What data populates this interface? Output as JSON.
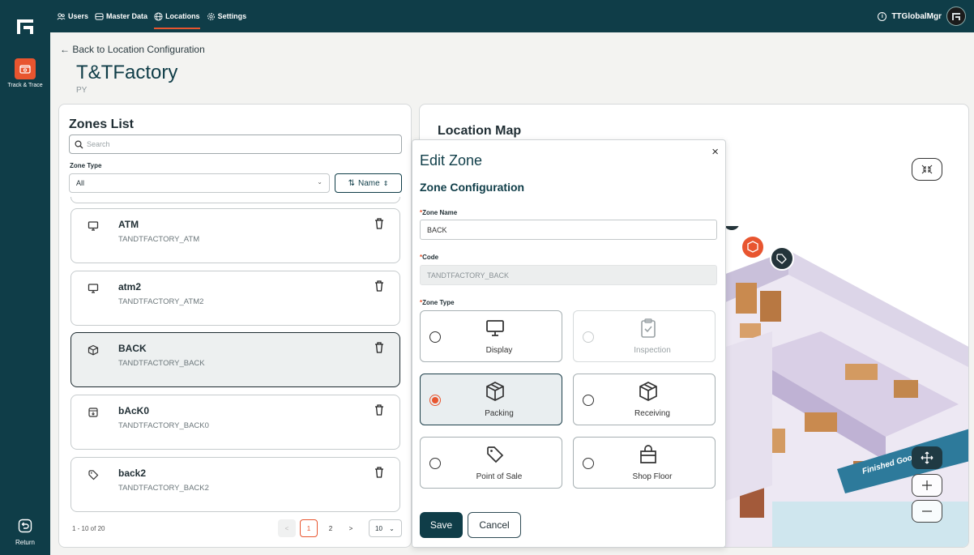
{
  "nav": {
    "items": [
      {
        "label": "Users",
        "icon": "users-icon"
      },
      {
        "label": "Master Data",
        "icon": "database-icon"
      },
      {
        "label": "Locations",
        "icon": "globe-icon"
      },
      {
        "label": "Settings",
        "icon": "gear-icon"
      }
    ],
    "active": "Locations",
    "user": "TTGlobalMgr"
  },
  "rail": {
    "app_label": "Track & Trace",
    "return_label": "Return"
  },
  "header": {
    "back_label": "← Back to Location Configuration",
    "title": "T&TFactory",
    "subtitle": "PY"
  },
  "zones_list": {
    "title": "Zones List",
    "search_placeholder": "Search",
    "zone_type_label": "Zone Type",
    "zone_type_value": "All",
    "sort_label": "Name",
    "items": [
      {
        "name": "ATM",
        "code": "TANDTFACTORY_ATM",
        "icon": "display-icon"
      },
      {
        "name": "atm2",
        "code": "TANDTFACTORY_ATM2",
        "icon": "display-icon"
      },
      {
        "name": "BACK",
        "code": "TANDTFACTORY_BACK",
        "icon": "package-icon",
        "selected": true
      },
      {
        "name": "bAcK0",
        "code": "TANDTFACTORY_BACK0",
        "icon": "archive-icon"
      },
      {
        "name": "back2",
        "code": "TANDTFACTORY_BACK2",
        "icon": "tag-icon"
      }
    ],
    "pager": {
      "range": "1 - 10 of 20",
      "pages": [
        "1",
        "2"
      ],
      "current_page": "1",
      "page_size": "10"
    }
  },
  "location_map": {
    "title": "Location Map",
    "overlay_label": "Finished Goods"
  },
  "edit_zone": {
    "title": "Edit Zone",
    "section": "Zone Configuration",
    "zone_name_label": "Zone Name",
    "zone_name_value": "BACK",
    "code_label": "Code",
    "code_value": "TANDTFACTORY_BACK",
    "zone_type_label": "Zone Type",
    "required_mark": "*",
    "types": [
      {
        "label": "Display",
        "icon": "display-icon"
      },
      {
        "label": "Inspection",
        "icon": "clipboard-check-icon",
        "disabled": true
      },
      {
        "label": "Packing",
        "icon": "package-icon",
        "selected": true
      },
      {
        "label": "Receiving",
        "icon": "package-icon"
      },
      {
        "label": "Point of Sale",
        "icon": "tag-icon"
      },
      {
        "label": "Shop Floor",
        "icon": "shopping-bag-icon"
      }
    ],
    "save_label": "Save",
    "cancel_label": "Cancel",
    "close_glyph": "×"
  },
  "colors": {
    "brand": "#0f3d48",
    "accent": "#e8552f"
  }
}
